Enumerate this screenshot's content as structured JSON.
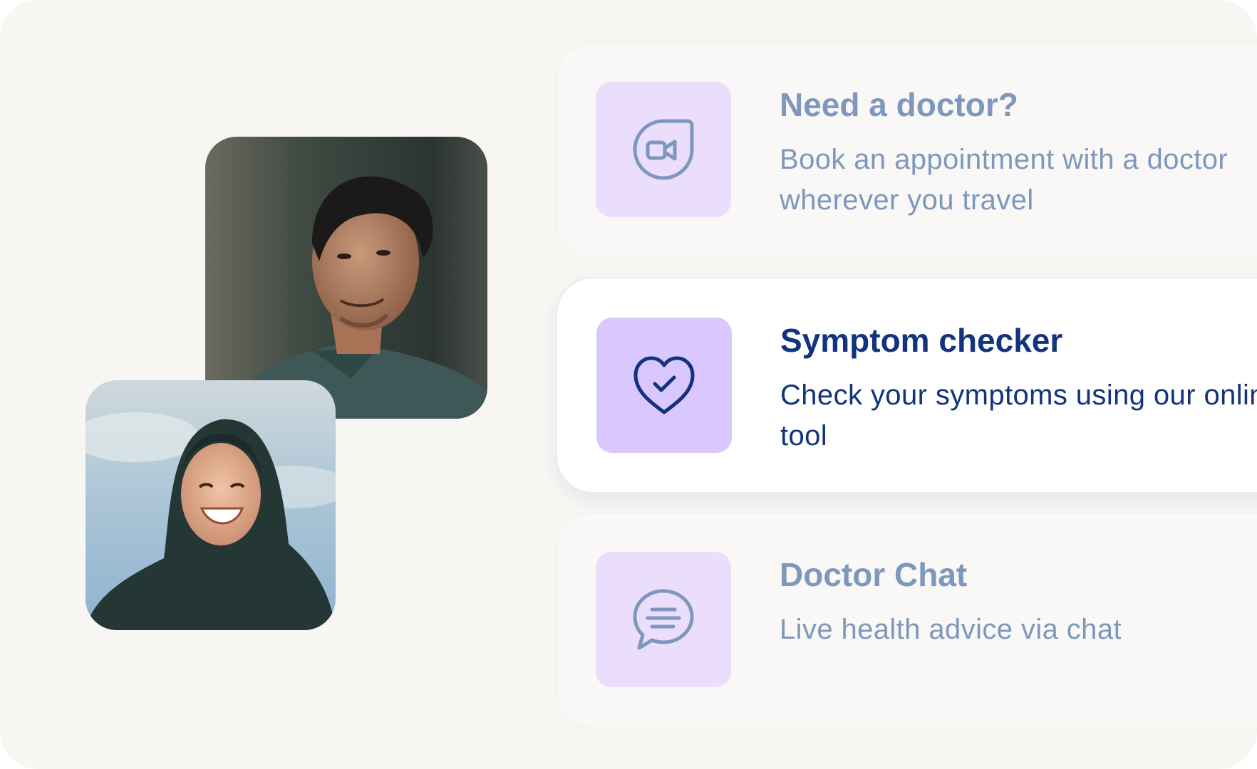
{
  "services": [
    {
      "title": "Need a doctor?",
      "description": "Book an appointment with a doctor wherever you travel",
      "icon": "video-call-icon",
      "state": "inactive"
    },
    {
      "title": "Symptom checker",
      "description": "Check your symptoms using our online tool",
      "icon": "heart-check-icon",
      "state": "active"
    },
    {
      "title": "Doctor Chat",
      "description": "Live health advice via chat",
      "icon": "chat-bubble-icon",
      "state": "inactive"
    }
  ],
  "colors": {
    "background": "#f7f6f3",
    "accent_text_active": "#11347c",
    "accent_text_inactive": "#7e97bd",
    "icon_tile_inactive": "#ebdefc",
    "icon_tile_active": "#dac7fd"
  }
}
